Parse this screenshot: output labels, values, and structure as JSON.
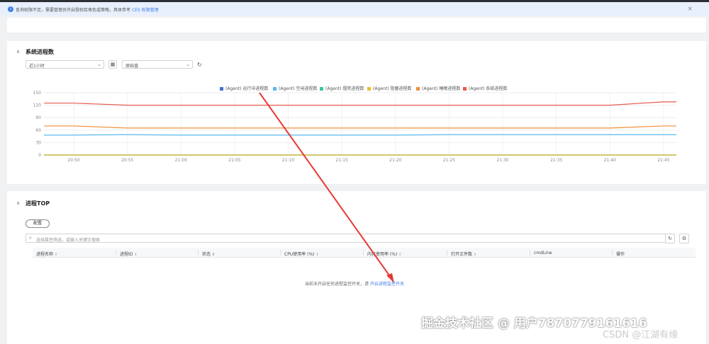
{
  "notice": {
    "text": "查询权限不足，需要管理员开启授权给角色或策略，具体参考",
    "link": "CES 权限管理"
  },
  "system_section": {
    "title": "系统进程数",
    "time_select": "近1小时",
    "agg_select": "原始值"
  },
  "chart_data": {
    "type": "line",
    "x": [
      "20:50",
      "20:55",
      "21:00",
      "21:05",
      "21:10",
      "21:15",
      "21:20",
      "21:25",
      "21:30",
      "21:35",
      "21:40",
      "21:45"
    ],
    "ylim": [
      0,
      150
    ],
    "yticks": [
      "150",
      "120",
      "90",
      "60",
      "30",
      "0"
    ],
    "grid": true,
    "legend_position": "top",
    "series": [
      {
        "name": "(Agent) 运行中进程数",
        "color": "#4a6fd3",
        "values": [
          0,
          0,
          0,
          0,
          0,
          0,
          0,
          0,
          0,
          0,
          0,
          0
        ]
      },
      {
        "name": "(Agent) 空闲进程数",
        "color": "#5bb8ec",
        "values": [
          48,
          49,
          48,
          48,
          48,
          48,
          48,
          49,
          49,
          49,
          49,
          49
        ]
      },
      {
        "name": "(Agent) 僵死进程数",
        "color": "#3fc4a4",
        "values": [
          0,
          0,
          0,
          0,
          0,
          0,
          0,
          0,
          0,
          0,
          0,
          0
        ]
      },
      {
        "name": "(Agent) 阻塞进程数",
        "color": "#e8c02a",
        "values": [
          0,
          0,
          0,
          0,
          0,
          0,
          0,
          0,
          0,
          0,
          0,
          0
        ]
      },
      {
        "name": "(Agent) 睡眠进程数",
        "color": "#ef8f3c",
        "values": [
          70,
          65,
          65,
          65,
          65,
          65,
          65,
          65,
          65,
          65,
          65,
          70
        ]
      },
      {
        "name": "(Agent) 系统进程数",
        "color": "#e85a4f",
        "values": [
          125,
          120,
          120,
          120,
          120,
          120,
          120,
          120,
          120,
          120,
          120,
          128
        ]
      }
    ]
  },
  "process_section": {
    "title": "进程TOP",
    "config_button": "配置",
    "search_placeholder": "选择属性筛选，或输入关键字搜索",
    "columns": [
      "进程名称",
      "进程ID",
      "状态",
      "CPU使用率 (%)",
      "内存使用率 (%)",
      "打开文件数",
      "cmdLine",
      "操作"
    ],
    "empty_text": "当前未开启任何进程监控开关，请",
    "empty_link": "开启进程监控开关"
  },
  "watermark": "掘金技术社区 @ 用户7870779161616",
  "csdn_watermark": "CSDN @江湖有缘"
}
